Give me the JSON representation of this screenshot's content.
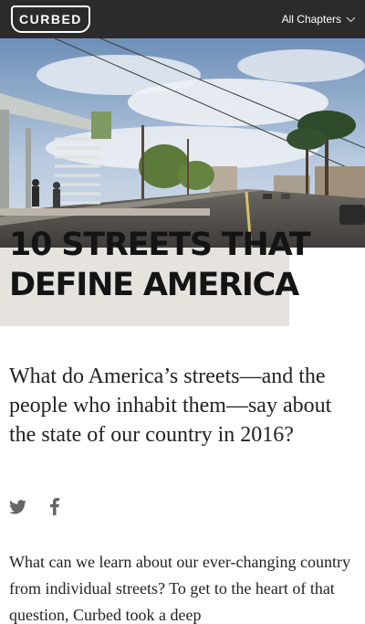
{
  "header": {
    "logo_text": "CURBED",
    "chapters_label": "All Chapters"
  },
  "article": {
    "headline": "10 Streets That Define America",
    "dek": "What do America’s streets—and the people who inhabit them—say about the state of our country in 2016?",
    "body": "What can we learn about our ever-changing country from individual streets? To get to the heart of that question, Curbed took a deep"
  },
  "social": [
    {
      "name": "twitter",
      "icon": "twitter-icon"
    },
    {
      "name": "facebook",
      "icon": "facebook-icon"
    }
  ],
  "colors": {
    "topbar": "#2b2b2b",
    "headline_bg": "#e6e3de",
    "headline_text": "#141414",
    "icon_gray": "#666666"
  }
}
